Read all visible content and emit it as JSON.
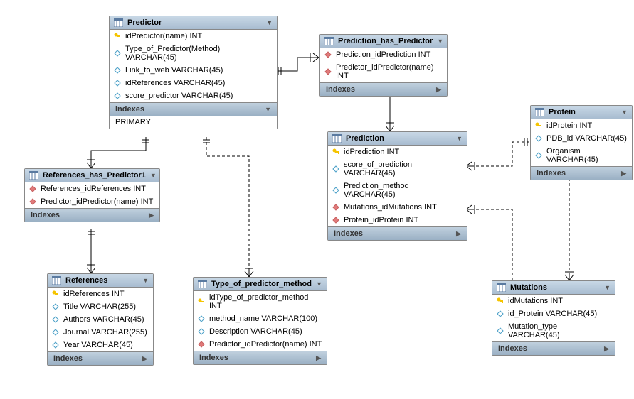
{
  "entities": {
    "predictor": {
      "title": "Predictor",
      "cols": [
        {
          "icon": "key",
          "text": "idPredictor(name) INT"
        },
        {
          "icon": "open",
          "text": "Type_of_Predictor(Method) VARCHAR(45)"
        },
        {
          "icon": "open",
          "text": "Link_to_web VARCHAR(45)"
        },
        {
          "icon": "open",
          "text": "idReferences VARCHAR(45)"
        },
        {
          "icon": "open",
          "text": "score_predictor VARCHAR(45)"
        }
      ],
      "indexes_label": "Indexes",
      "primary_label": "PRIMARY"
    },
    "prediction_has_predictor": {
      "title": "Prediction_has_Predictor",
      "cols": [
        {
          "icon": "fill",
          "text": "Prediction_idPrediction INT"
        },
        {
          "icon": "fill",
          "text": "Predictor_idPredictor(name) INT"
        }
      ],
      "indexes_label": "Indexes"
    },
    "protein": {
      "title": "Protein",
      "cols": [
        {
          "icon": "key",
          "text": "idProtein INT"
        },
        {
          "icon": "open",
          "text": "PDB_id VARCHAR(45)"
        },
        {
          "icon": "open",
          "text": "Organism VARCHAR(45)"
        }
      ],
      "indexes_label": "Indexes"
    },
    "references_has_predictor1": {
      "title": "References_has_Predictor1",
      "cols": [
        {
          "icon": "fill",
          "text": "References_idReferences INT"
        },
        {
          "icon": "fill",
          "text": "Predictor_idPredictor(name) INT"
        }
      ],
      "indexes_label": "Indexes"
    },
    "prediction": {
      "title": "Prediction",
      "cols": [
        {
          "icon": "key",
          "text": "idPrediction INT"
        },
        {
          "icon": "open",
          "text": "score_of_prediction VARCHAR(45)"
        },
        {
          "icon": "open",
          "text": "Prediction_method VARCHAR(45)"
        },
        {
          "icon": "fill",
          "text": "Mutations_idMutations INT"
        },
        {
          "icon": "fill",
          "text": "Protein_idProtein INT"
        }
      ],
      "indexes_label": "Indexes"
    },
    "references": {
      "title": "References",
      "cols": [
        {
          "icon": "key",
          "text": "idReferences INT"
        },
        {
          "icon": "open",
          "text": "Title VARCHAR(255)"
        },
        {
          "icon": "open",
          "text": "Authors VARCHAR(45)"
        },
        {
          "icon": "open",
          "text": "Journal VARCHAR(255)"
        },
        {
          "icon": "open",
          "text": "Year VARCHAR(45)"
        }
      ],
      "indexes_label": "Indexes"
    },
    "type_of_predictor_method": {
      "title": "Type_of_predictor_method",
      "cols": [
        {
          "icon": "key",
          "text": "idType_of_predictor_method INT"
        },
        {
          "icon": "open",
          "text": "method_name VARCHAR(100)"
        },
        {
          "icon": "open",
          "text": "Description VARCHAR(45)"
        },
        {
          "icon": "fill",
          "text": "Predictor_idPredictor(name) INT"
        }
      ],
      "indexes_label": "Indexes"
    },
    "mutations": {
      "title": "Mutations",
      "cols": [
        {
          "icon": "key",
          "text": "idMutations INT"
        },
        {
          "icon": "open",
          "text": "id_Protein VARCHAR(45)"
        },
        {
          "icon": "open",
          "text": "Mutation_type VARCHAR(45)"
        }
      ],
      "indexes_label": "Indexes"
    }
  }
}
